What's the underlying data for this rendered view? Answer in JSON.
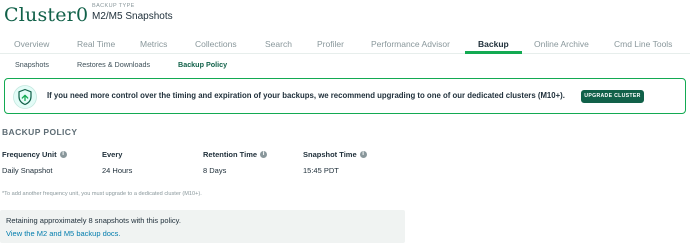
{
  "header": {
    "cluster_name": "Cluster0",
    "backup_type_label": "BACKUP TYPE",
    "backup_type_value": "M2/M5 Snapshots"
  },
  "tabs": [
    {
      "label": "Overview"
    },
    {
      "label": "Real Time"
    },
    {
      "label": "Metrics"
    },
    {
      "label": "Collections"
    },
    {
      "label": "Search"
    },
    {
      "label": "Profiler"
    },
    {
      "label": "Performance Advisor"
    },
    {
      "label": "Backup",
      "active": true
    },
    {
      "label": "Online Archive"
    },
    {
      "label": "Cmd Line Tools"
    }
  ],
  "subtabs": [
    {
      "label": "Snapshots"
    },
    {
      "label": "Restores & Downloads"
    },
    {
      "label": "Backup Policy",
      "active": true
    }
  ],
  "banner": {
    "icon": "shield-upgrade-icon",
    "text": "If you need more control over the timing and expiration of your backups, we recommend upgrading to one of our dedicated clusters (M10+).",
    "button_label": "UPGRADE CLUSTER"
  },
  "policy": {
    "title": "BACKUP POLICY",
    "columns": [
      {
        "header": "Frequency Unit",
        "value": "Daily Snapshot",
        "info": true
      },
      {
        "header": "Every",
        "value": "24 Hours",
        "info": false
      },
      {
        "header": "Retention Time",
        "value": "8 Days",
        "info": true
      },
      {
        "header": "Snapshot Time",
        "value": "15:45 PDT",
        "info": true
      }
    ],
    "footnote": "*To add another frequency unit, you must upgrade to a dedicated cluster (M10+).",
    "retain_text": "Retaining approximately 8 snapshots with this policy.",
    "docs_link": "View the M2 and M5 backup docs."
  },
  "colors": {
    "accent": "#13aa52",
    "brand_dark": "#116149",
    "link": "#007cad"
  }
}
